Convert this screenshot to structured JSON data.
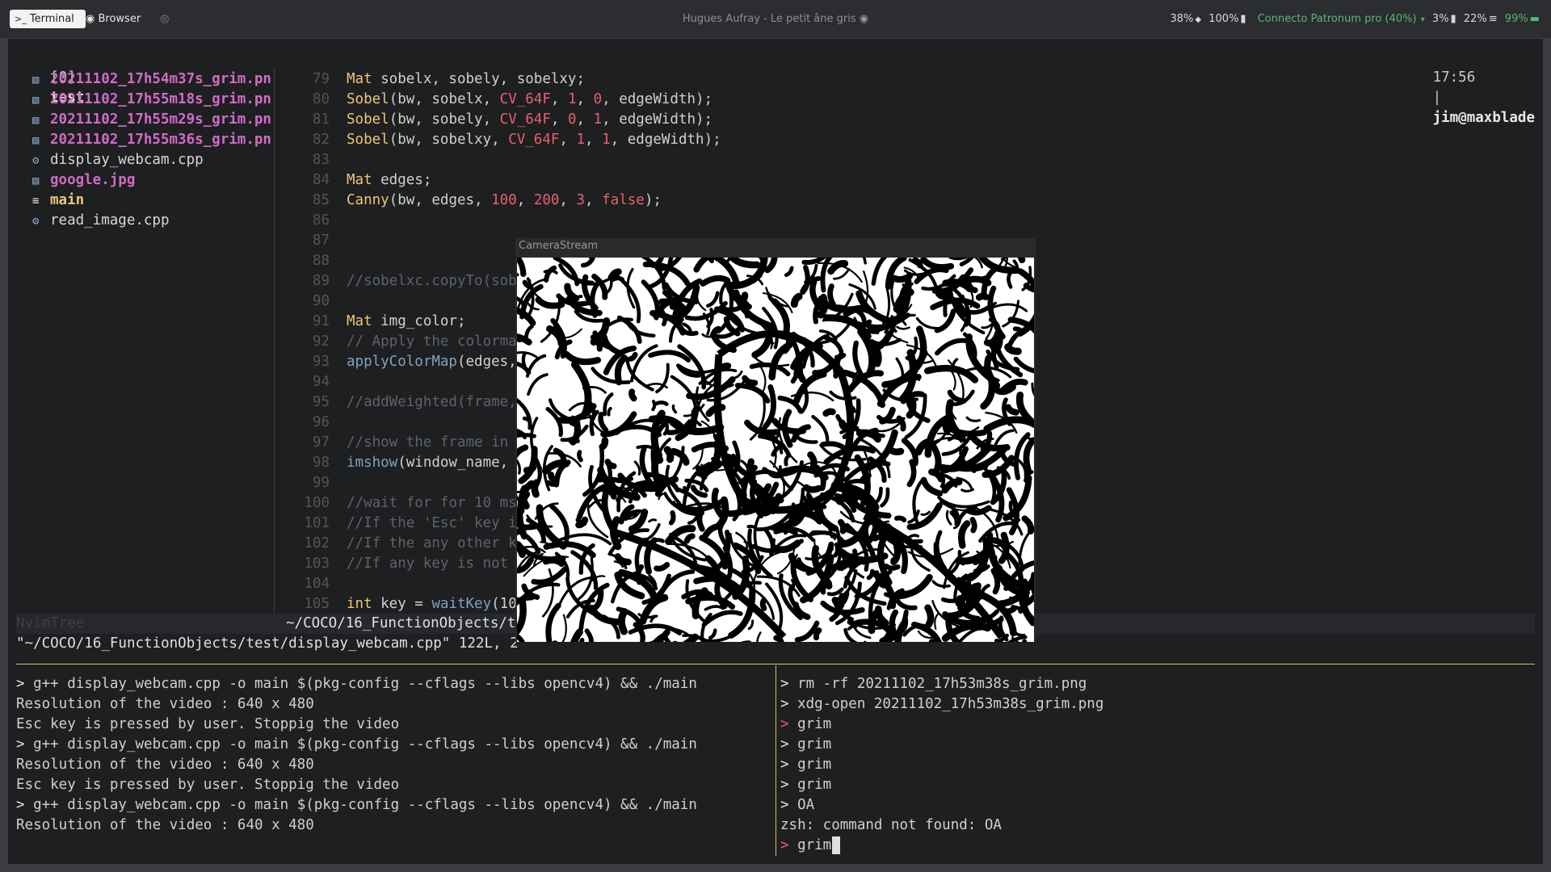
{
  "topbar": {
    "tabs": [
      {
        "icon": "terminal-icon",
        "label": "Terminal"
      },
      {
        "icon": "browser-icon",
        "label": "Browser"
      }
    ],
    "media_title": "Hugues Aufray - Le petit âne gris",
    "status": {
      "brightness": "38%",
      "volume": "100%",
      "network": "Connecto Patronum pro (40%)",
      "cpu": "3%",
      "memory": "22%",
      "battery": "99%",
      "network_color": "#59b86b",
      "battery_color": "#59b86b"
    }
  },
  "tmux": {
    "session": "[0]",
    "window_name": "test",
    "time": "17:56",
    "separator": "|",
    "user_host": "jim@maxblade"
  },
  "tree": {
    "items": [
      {
        "name": "20211102_17h54m37s_grim.pn",
        "kind": "image"
      },
      {
        "name": "20211102_17h55m18s_grim.pn",
        "kind": "image"
      },
      {
        "name": "20211102_17h55m29s_grim.pn",
        "kind": "image"
      },
      {
        "name": "20211102_17h55m36s_grim.pn",
        "kind": "image"
      },
      {
        "name": "display_webcam.cpp",
        "kind": "cpp"
      },
      {
        "name": "google.jpg",
        "kind": "image"
      },
      {
        "name": "main",
        "kind": "exec"
      },
      {
        "name": "read_image.cpp",
        "kind": "cpp"
      }
    ],
    "statusline_label": "NvimTree"
  },
  "editor": {
    "lines": [
      {
        "num": "79",
        "segs": [
          {
            "t": "Mat",
            "c": "kw-type"
          },
          {
            "t": " sobelx, sobely, sobelxy;"
          }
        ]
      },
      {
        "num": "80",
        "segs": [
          {
            "t": "Sobel",
            "c": "fn-y"
          },
          {
            "t": "(bw, sobelx, "
          },
          {
            "t": "CV_64F",
            "c": "const"
          },
          {
            "t": ", "
          },
          {
            "t": "1",
            "c": "num"
          },
          {
            "t": ", "
          },
          {
            "t": "0",
            "c": "num"
          },
          {
            "t": ", edgeWidth);"
          }
        ]
      },
      {
        "num": "81",
        "segs": [
          {
            "t": "Sobel",
            "c": "fn-y"
          },
          {
            "t": "(bw, sobely, "
          },
          {
            "t": "CV_64F",
            "c": "const"
          },
          {
            "t": ", "
          },
          {
            "t": "0",
            "c": "num"
          },
          {
            "t": ", "
          },
          {
            "t": "1",
            "c": "num"
          },
          {
            "t": ", edgeWidth);"
          }
        ]
      },
      {
        "num": "82",
        "segs": [
          {
            "t": "Sobel",
            "c": "fn-y"
          },
          {
            "t": "(bw, sobelxy, "
          },
          {
            "t": "CV_64F",
            "c": "const"
          },
          {
            "t": ", "
          },
          {
            "t": "1",
            "c": "num"
          },
          {
            "t": ", "
          },
          {
            "t": "1",
            "c": "num"
          },
          {
            "t": ", edgeWidth);"
          }
        ]
      },
      {
        "num": "83",
        "segs": []
      },
      {
        "num": "84",
        "segs": [
          {
            "t": "Mat",
            "c": "kw-type"
          },
          {
            "t": " edges;"
          }
        ]
      },
      {
        "num": "85",
        "segs": [
          {
            "t": "Canny",
            "c": "fn-y"
          },
          {
            "t": "(bw, edges, "
          },
          {
            "t": "100",
            "c": "num"
          },
          {
            "t": ", "
          },
          {
            "t": "200",
            "c": "num"
          },
          {
            "t": ", "
          },
          {
            "t": "3",
            "c": "num"
          },
          {
            "t": ", "
          },
          {
            "t": "false",
            "c": "const"
          },
          {
            "t": ");"
          }
        ]
      },
      {
        "num": "86",
        "segs": []
      },
      {
        "num": "87",
        "segs": []
      },
      {
        "num": "88",
        "segs": []
      },
      {
        "num": "89",
        "segs": [
          {
            "t": "//sobelxc.copyTo(sob",
            "c": "cmt"
          }
        ]
      },
      {
        "num": "90",
        "segs": []
      },
      {
        "num": "91",
        "segs": [
          {
            "t": "Mat",
            "c": "kw-type"
          },
          {
            "t": " img_color;"
          }
        ]
      },
      {
        "num": "92",
        "segs": [
          {
            "t": "// Apply the colorma",
            "c": "cmt"
          }
        ]
      },
      {
        "num": "93",
        "segs": [
          {
            "t": "applyColorMap",
            "c": "fn-b"
          },
          {
            "t": "(edges,"
          }
        ]
      },
      {
        "num": "94",
        "segs": []
      },
      {
        "num": "95",
        "segs": [
          {
            "t": "//addWeighted(frame,",
            "c": "cmt"
          }
        ]
      },
      {
        "num": "96",
        "segs": []
      },
      {
        "num": "97",
        "segs": [
          {
            "t": "//show the frame in ",
            "c": "cmt"
          }
        ]
      },
      {
        "num": "98",
        "segs": [
          {
            "t": "imshow",
            "c": "fn-b"
          },
          {
            "t": "(window_name, "
          }
        ]
      },
      {
        "num": "99",
        "segs": []
      },
      {
        "num": "100",
        "segs": [
          {
            "t": "//wait for for 10 ms",
            "c": "cmt"
          }
        ]
      },
      {
        "num": "101",
        "segs": [
          {
            "t": "//If the 'Esc' key i",
            "c": "cmt"
          }
        ]
      },
      {
        "num": "102",
        "segs": [
          {
            "t": "//If the any other k",
            "c": "cmt"
          }
        ]
      },
      {
        "num": "103",
        "segs": [
          {
            "t": "//If any key is not ",
            "c": "cmt"
          }
        ]
      },
      {
        "num": "104",
        "segs": []
      },
      {
        "num": "105",
        "segs": [
          {
            "t": "int",
            "c": "kw-type"
          },
          {
            "t": " key = "
          },
          {
            "t": "waitKey",
            "c": "fn-b"
          },
          {
            "t": "(10"
          }
        ]
      }
    ],
    "statusline_path": "~/COCO/16_FunctionObjects/te",
    "cmdline": "\"~/COCO/16_FunctionObjects/test/display_webcam.cpp\" 122L, 2"
  },
  "camera_window": {
    "title": "CameraStream"
  },
  "left_pane": {
    "lines": [
      {
        "prompt": "> ",
        "text": "g++ display_webcam.cpp -o main $(pkg-config --cflags --libs opencv4) && ./main"
      },
      {
        "prompt": "",
        "text": "Resolution of the video : 640 x 480"
      },
      {
        "prompt": "",
        "text": "Esc key is pressed by user. Stoppig the video"
      },
      {
        "prompt": "> ",
        "text": "g++ display_webcam.cpp -o main $(pkg-config --cflags --libs opencv4) && ./main"
      },
      {
        "prompt": "",
        "text": "Resolution of the video : 640 x 480"
      },
      {
        "prompt": "",
        "text": "Esc key is pressed by user. Stoppig the video"
      },
      {
        "prompt": "> ",
        "text": "g++ display_webcam.cpp -o main $(pkg-config --cflags --libs opencv4) && ./main"
      },
      {
        "prompt": "",
        "text": "Resolution of the video : 640 x 480"
      }
    ]
  },
  "right_pane": {
    "lines": [
      {
        "prompt": "> ",
        "text": "rm -rf 20211102_17h53m38s_grim.png",
        "red": false
      },
      {
        "prompt": "> ",
        "text": "xdg-open 20211102_17h53m38s_grim.png",
        "red": false
      },
      {
        "prompt": "> ",
        "text": "grim",
        "red": true
      },
      {
        "prompt": "> ",
        "text": "grim",
        "red": false
      },
      {
        "prompt": "> ",
        "text": "grim",
        "red": false
      },
      {
        "prompt": "> ",
        "text": "grim",
        "red": false
      },
      {
        "prompt": "> ",
        "text": "OA",
        "red": false
      },
      {
        "prompt": "",
        "text": "zsh: command not found: OA",
        "red": false
      },
      {
        "prompt": "> ",
        "text": "grim",
        "red": true,
        "cursor": true
      }
    ]
  },
  "colors": {
    "accent_yellow": "#c8c86a",
    "accent_green": "#59b86b",
    "image_file": "#d26ac7",
    "error_red": "#e7606b"
  }
}
